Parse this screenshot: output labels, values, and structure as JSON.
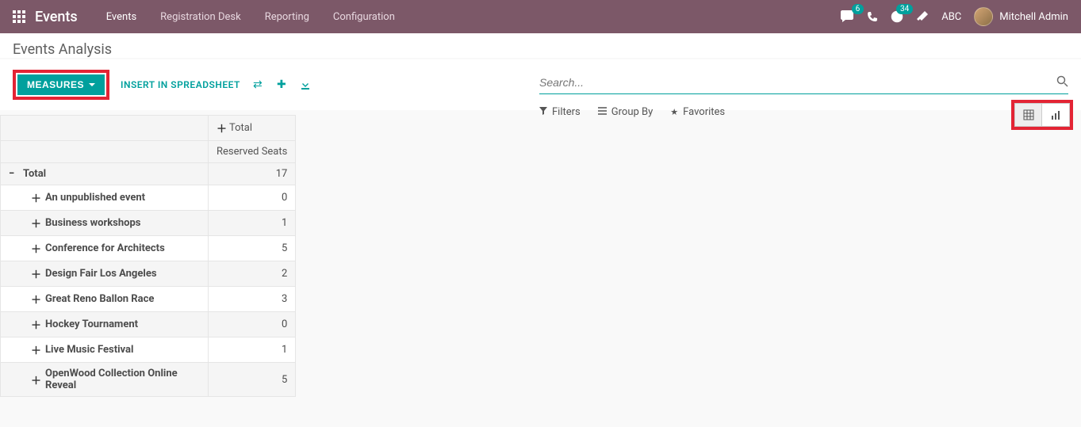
{
  "navbar": {
    "brand": "Events",
    "links": [
      "Events",
      "Registration Desk",
      "Reporting",
      "Configuration"
    ],
    "messages_badge": "6",
    "activities_badge": "34",
    "abc": "ABC",
    "user_name": "Mitchell Admin"
  },
  "page": {
    "title": "Events Analysis",
    "search_placeholder": "Search..."
  },
  "controls": {
    "measures_label": "MEASURES",
    "spreadsheet_label": "INSERT IN SPREADSHEET",
    "filters_label": "Filters",
    "groupby_label": "Group By",
    "favorites_label": "Favorites"
  },
  "pivot": {
    "col_total": "Total",
    "col_measure": "Reserved Seats",
    "row_total_label": "Total",
    "row_total_value": "17",
    "rows": [
      {
        "label": "An unpublished event",
        "value": "0"
      },
      {
        "label": "Business workshops",
        "value": "1"
      },
      {
        "label": "Conference for Architects",
        "value": "5"
      },
      {
        "label": "Design Fair Los Angeles",
        "value": "2"
      },
      {
        "label": "Great Reno Ballon Race",
        "value": "3"
      },
      {
        "label": "Hockey Tournament",
        "value": "0"
      },
      {
        "label": "Live Music Festival",
        "value": "1"
      },
      {
        "label": "OpenWood Collection Online Reveal",
        "value": "5"
      }
    ]
  }
}
